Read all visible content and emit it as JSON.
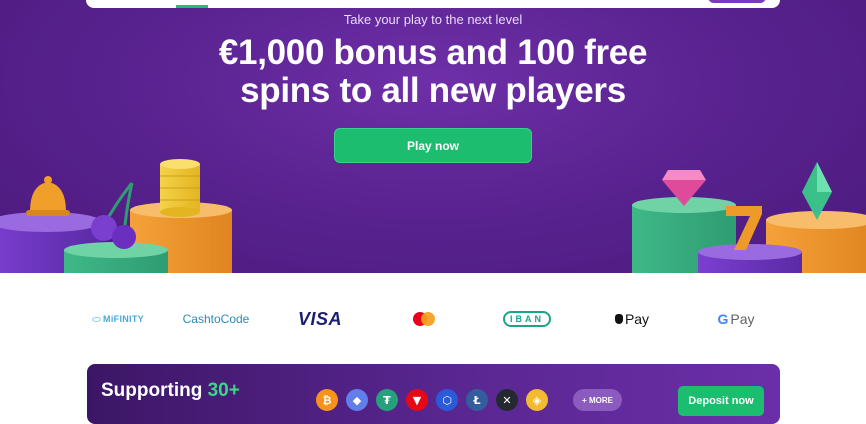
{
  "hero": {
    "tagline": "Take your play to the next level",
    "headline_line1": "€1,000 bonus and 100 free",
    "headline_line2": "spins to all new players",
    "cta_label": "Play now"
  },
  "payments": [
    {
      "name": "mifinity",
      "label": "MiFINITY",
      "color": "#4aa7d8"
    },
    {
      "name": "cashtocode",
      "label": "CashtoCode",
      "color": "#2a8bb8"
    },
    {
      "name": "visa",
      "label": "VISA",
      "color": "#1a1f71"
    },
    {
      "name": "mastercard",
      "label": "",
      "color": "#eb001b"
    },
    {
      "name": "iban",
      "label": "IBAN",
      "color": "#1aa48a"
    },
    {
      "name": "apple-pay",
      "label": "Pay",
      "color": "#111111"
    },
    {
      "name": "google-pay",
      "label": "Pay",
      "color": "#5f6368"
    }
  ],
  "crypto": {
    "title_prefix": "Supporting ",
    "title_accent": "30+",
    "coins": [
      {
        "name": "bitcoin-icon",
        "glyph": "₿",
        "color": "#f7931a"
      },
      {
        "name": "ethereum-icon",
        "glyph": "◆",
        "color": "#627eea"
      },
      {
        "name": "tether-icon",
        "glyph": "₮",
        "color": "#26a17b"
      },
      {
        "name": "tron-icon",
        "glyph": "▼",
        "color": "#e50915"
      },
      {
        "name": "chainlink-icon",
        "glyph": "⬡",
        "color": "#2a5ada"
      },
      {
        "name": "litecoin-icon",
        "glyph": "Ł",
        "color": "#345d9d"
      },
      {
        "name": "xrp-icon",
        "glyph": "✕",
        "color": "#23292f"
      },
      {
        "name": "binance-icon",
        "glyph": "◈",
        "color": "#f3ba2f"
      }
    ],
    "more_label": "+ MORE",
    "deposit_label": "Deposit now"
  }
}
